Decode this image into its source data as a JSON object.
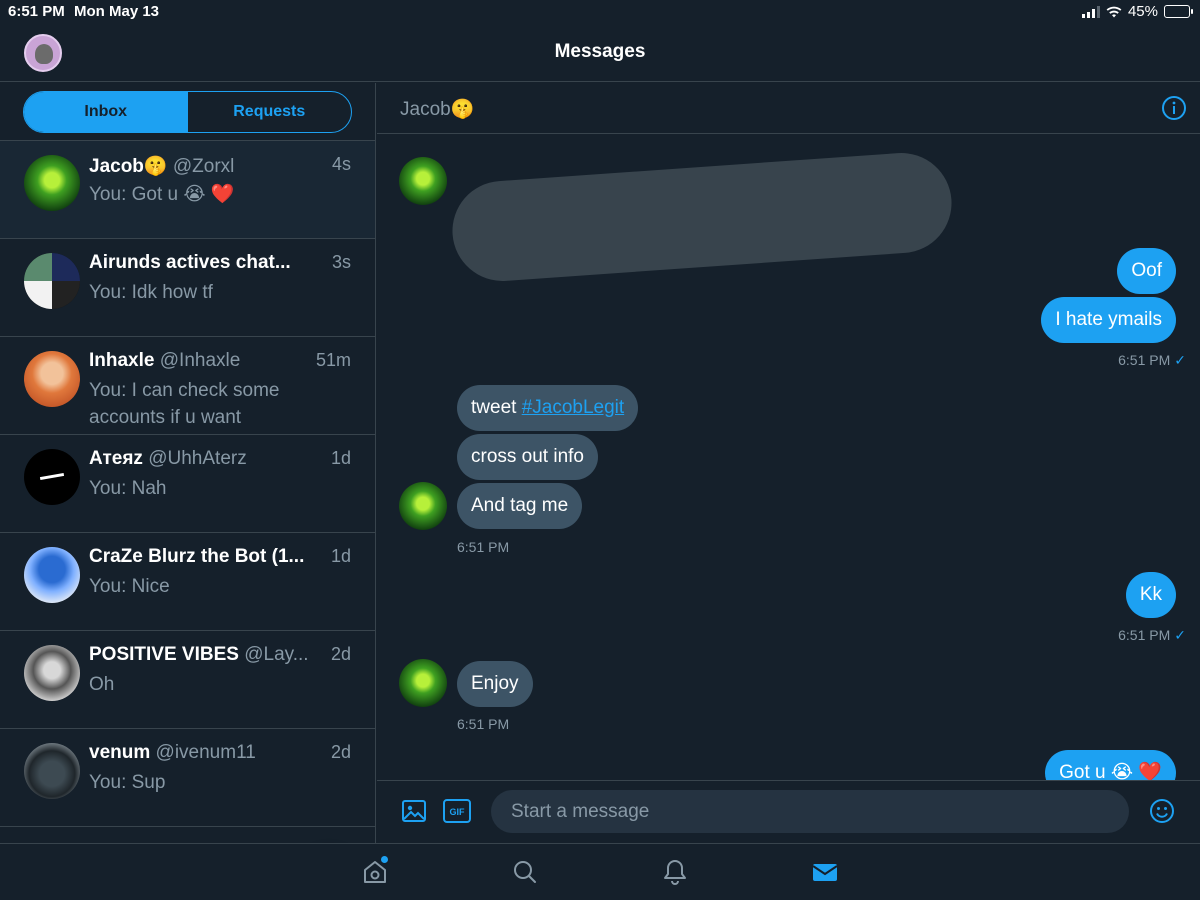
{
  "status_bar": {
    "time": "6:51 PM",
    "date": "Mon May 13",
    "battery": "45%",
    "battery_level": 0.45
  },
  "header": {
    "title": "Messages",
    "avatar_icon": "profile-avatar"
  },
  "segments": {
    "inbox": "Inbox",
    "requests": "Requests"
  },
  "conversations": [
    {
      "name": "Jacob🤫",
      "handle": "@Zorxl",
      "time": "4s",
      "preview": "You: Got u 😭 ❤️",
      "selected": true
    },
    {
      "name": "Airunds actives chat...",
      "handle": "",
      "time": "3s",
      "preview": "You: Idk how tf"
    },
    {
      "name": "Inhaxle",
      "handle": "@Inhaxle",
      "time": "51m",
      "preview": "You: I can check some accounts if u want"
    },
    {
      "name": "Атеяz",
      "handle": "@UhhAterz",
      "time": "1d",
      "preview": "You: Nah"
    },
    {
      "name": "CraZe Blurz the Bot (1...",
      "handle": "",
      "time": "1d",
      "preview": "You: Nice"
    },
    {
      "name": "POSITIVE VIBES",
      "handle": "@Lay...",
      "time": "2d",
      "preview": "Oh"
    },
    {
      "name": "venum",
      "handle": "@ivenum11",
      "time": "2d",
      "preview": "You: Sup"
    }
  ],
  "chat": {
    "title": "Jacob🤫",
    "messages": {
      "out1": "Oof",
      "out2": "I hate ymails",
      "out1_time": "6:51 PM",
      "in1_prefix": "tweet ",
      "in1_tag": "#JacobLegit",
      "in2": "cross out info",
      "in3": "And tag me",
      "in_time": "6:51 PM",
      "out3": "Kk",
      "out3_time": "6:51 PM",
      "in4": "Enjoy",
      "in4_time": "6:51 PM",
      "out4": "Got u 😭 ❤️"
    },
    "composer_placeholder": "Start a message"
  },
  "tabbar": {
    "active": "messages",
    "icons": [
      "home-icon",
      "search-icon",
      "notifications-icon",
      "messages-icon"
    ]
  },
  "colors": {
    "background": "#15202b",
    "accent": "#1da1f2",
    "incoming_bubble": "#3d5466",
    "muted": "#8899a6",
    "divider": "#38444d"
  }
}
